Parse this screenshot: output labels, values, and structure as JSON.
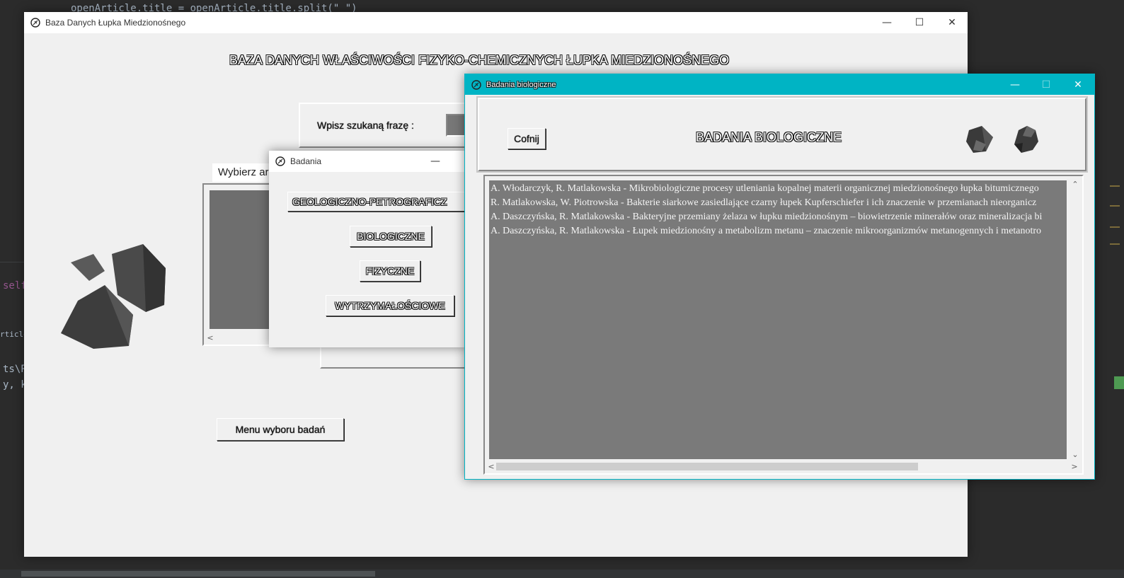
{
  "ide": {
    "code_top": "openArticle.title = openArticle.title.split(\" \")",
    "code_self": "self",
    "code_article": "rticle_s",
    "code_path": "ts\\P",
    "code_args": "y, k"
  },
  "main_window": {
    "title": "Baza Danych Łupka Miedzionośnego",
    "heading": "BAZA DANYCH WŁAŚCIWOŚCI FIZYKO-CHEMICZNYCH ŁUPKA MIEDZIONOŚNEGO",
    "search_label": "Wpisz szukaną frazę :",
    "choose_label": "Wybierz ar",
    "menu_button": "Menu wyboru badań",
    "controls": {
      "minimize": "—",
      "maximize": "☐",
      "close": "✕"
    }
  },
  "badania_window": {
    "title": "Badania",
    "buttons": [
      "GEOLOGICZNO-PETROGRAFICZ",
      "BIOLOGICZNE",
      "FIZYCZNE",
      "WYTRZYMAŁOŚCIOWE"
    ],
    "controls": {
      "minimize": "—"
    }
  },
  "bio_window": {
    "title": "Badania biologiczne",
    "heading": "BADANIA BIOLOGICZNE",
    "back_button": "Cofnij",
    "accent_color": "#00b4c4",
    "controls": {
      "minimize": "—",
      "maximize": "☐",
      "close": "✕"
    },
    "articles": [
      "A. Włodarczyk, R. Matlakowska - Mikrobiologiczne procesy utleniania kopalnej materii organicznej miedzionośnego łupka bitumicznego",
      "R. Matlakowska, W. Piotrowska - Bakterie siarkowe zasiedlające czarny łupek Kupferschiefer i ich znaczenie w przemianach nieorganicz",
      "A. Daszczyńska, R. Matlakowska - Bakteryjne przemiany żelaza w łupku miedzionośnym – biowietrzenie minerałów oraz mineralizacja bi",
      "A. Daszczyńska, R. Matlakowska - Łupek miedzionośny a metabolizm metanu – znaczenie mikroorganizmów metanogennych i metanotro"
    ]
  }
}
